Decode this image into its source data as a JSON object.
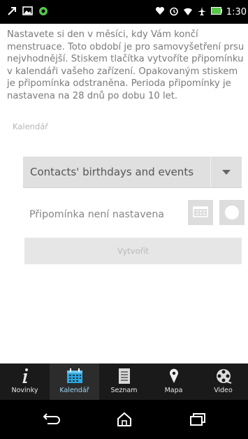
{
  "status_bar": {
    "time": "1:30",
    "left_icons": [
      "notification-icon",
      "image-icon",
      "app-icon"
    ],
    "right_icons": [
      "heart-icon",
      "alarm-icon",
      "wifi-icon",
      "airplane-icon",
      "battery-icon"
    ]
  },
  "description": "Nastavete si den v měsíci, kdy Vám končí menstruace. Toto období je pro samovyšetření prsu nejvhodnější. Stiskem tlačítka vytvoříte připomínku v kalendáři vašeho zařízení. Opakovaným stiskem je připomínka odstraněna. Perioda připomínky je nastavena na 28 dnů po dobu 10 let.",
  "calendar": {
    "label": "Kalendář",
    "selected": "Contacts' birthdays and events"
  },
  "reminder": {
    "status": "Připomínka není nastavena"
  },
  "create_button": "Vytvořit",
  "tabs": [
    {
      "label": "Novinky",
      "icon": "info-icon",
      "active": false
    },
    {
      "label": "Kalendář",
      "icon": "calendar-icon",
      "active": true
    },
    {
      "label": "Seznam",
      "icon": "list-icon",
      "active": false
    },
    {
      "label": "Mapa",
      "icon": "map-pin-icon",
      "active": false
    },
    {
      "label": "Video",
      "icon": "film-reel-icon",
      "active": false
    }
  ],
  "navbar": [
    "back-icon",
    "home-icon",
    "recent-apps-icon"
  ],
  "colors": {
    "accent": "#29a7e3",
    "tabbar_bg": "#1a1a1a"
  }
}
